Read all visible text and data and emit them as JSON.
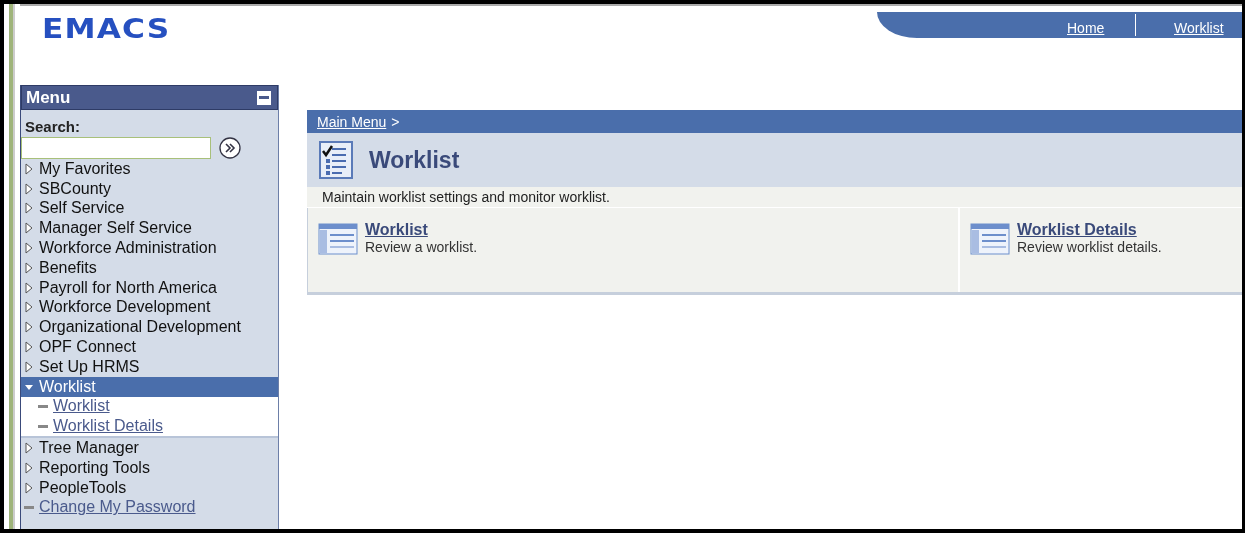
{
  "logo": "EMACS",
  "nav": [
    "Home",
    "Worklist"
  ],
  "menu": {
    "title": "Menu",
    "search_label": "Search:",
    "items": [
      {
        "label": "My Favorites",
        "kind": "folder",
        "expanded": false
      },
      {
        "label": "SBCounty",
        "kind": "folder",
        "expanded": false
      },
      {
        "label": "Self Service",
        "kind": "folder",
        "expanded": false
      },
      {
        "label": "Manager Self Service",
        "kind": "folder",
        "expanded": false
      },
      {
        "label": "Workforce Administration",
        "kind": "folder",
        "expanded": false
      },
      {
        "label": "Benefits",
        "kind": "folder",
        "expanded": false
      },
      {
        "label": "Payroll for North America",
        "kind": "folder",
        "expanded": false
      },
      {
        "label": "Workforce Development",
        "kind": "folder",
        "expanded": false
      },
      {
        "label": "Organizational Development",
        "kind": "folder",
        "expanded": false
      },
      {
        "label": "OPF Connect",
        "kind": "folder",
        "expanded": false
      },
      {
        "label": "Set Up HRMS",
        "kind": "folder",
        "expanded": false
      },
      {
        "label": "Worklist",
        "kind": "folder",
        "expanded": true,
        "children": [
          {
            "label": "Worklist",
            "kind": "link"
          },
          {
            "label": "Worklist Details",
            "kind": "link"
          }
        ]
      },
      {
        "label": "Tree Manager",
        "kind": "folder",
        "expanded": false
      },
      {
        "label": "Reporting Tools",
        "kind": "folder",
        "expanded": false
      },
      {
        "label": "PeopleTools",
        "kind": "folder",
        "expanded": false
      },
      {
        "label": "Change My Password",
        "kind": "link"
      }
    ]
  },
  "breadcrumb": {
    "link": "Main Menu",
    "separator": ">"
  },
  "page_title": "Worklist",
  "description": "Maintain worklist settings and monitor worklist.",
  "cards": [
    {
      "title": "Worklist",
      "text": "Review a worklist."
    },
    {
      "title": "Worklist Details",
      "text": "Review worklist details."
    }
  ]
}
